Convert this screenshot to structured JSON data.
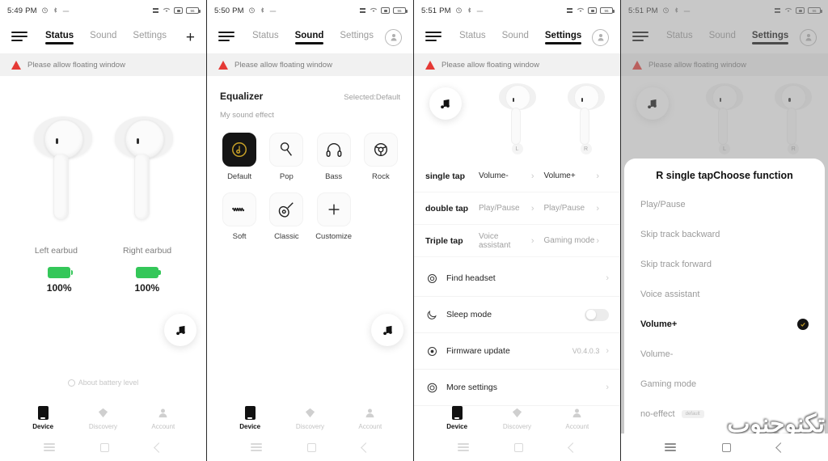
{
  "panels": [
    {
      "status": {
        "time": "5:49 PM",
        "icons": [
          "alarm-icon",
          "bluetooth-icon",
          "dash-icon"
        ],
        "right_icons": [
          "signal-icon",
          "wifi-icon",
          "screenshot-icon",
          "battery-icon"
        ],
        "battery_text": "96"
      },
      "tabs": [
        {
          "label": "Status",
          "active": true
        },
        {
          "label": "Sound",
          "active": false
        },
        {
          "label": "Settings",
          "active": false
        }
      ],
      "tab_right": {
        "type": "plus",
        "label": "+"
      },
      "warning": "Please allow floating window",
      "earbuds": {
        "left_label": "Left earbud",
        "right_label": "Right earbud",
        "left_battery": "100%",
        "right_battery": "100%",
        "battery_color": "#34c759"
      },
      "about": "About battery level",
      "bottom_nav": [
        {
          "label": "Device",
          "active": true
        },
        {
          "label": "Discovery",
          "active": false
        },
        {
          "label": "Account",
          "active": false
        }
      ]
    },
    {
      "status": {
        "time": "5:50 PM",
        "battery_text": "96"
      },
      "tabs": [
        {
          "label": "Status",
          "active": false
        },
        {
          "label": "Sound",
          "active": true
        },
        {
          "label": "Settings",
          "active": false
        }
      ],
      "tab_right": {
        "type": "avatar"
      },
      "warning": "Please allow floating window",
      "equalizer": {
        "title": "Equalizer",
        "selected_label": "Selected:Default",
        "subtitle": "My sound effect",
        "presets": [
          {
            "label": "Default",
            "icon": "disc-icon",
            "selected": true
          },
          {
            "label": "Pop",
            "icon": "microphone-icon",
            "selected": false
          },
          {
            "label": "Bass",
            "icon": "headphones-icon",
            "selected": false
          },
          {
            "label": "Rock",
            "icon": "rock-disc-icon",
            "selected": false
          },
          {
            "label": "Soft",
            "icon": "wave-icon",
            "selected": false
          },
          {
            "label": "Classic",
            "icon": "guitar-icon",
            "selected": false
          },
          {
            "label": "Customize",
            "icon": "plus-icon",
            "selected": false
          }
        ]
      },
      "bottom_nav": [
        {
          "label": "Device",
          "active": true
        },
        {
          "label": "Discovery",
          "active": false
        },
        {
          "label": "Account",
          "active": false
        }
      ]
    },
    {
      "status": {
        "time": "5:51 PM",
        "battery_text": "96"
      },
      "tabs": [
        {
          "label": "Status",
          "active": false
        },
        {
          "label": "Sound",
          "active": false
        },
        {
          "label": "Settings",
          "active": true
        }
      ],
      "tab_right": {
        "type": "avatar"
      },
      "warning": "Please allow floating window",
      "bud_badges": {
        "left": "L",
        "right": "R"
      },
      "tap_rows": [
        {
          "name": "single tap",
          "left": "Volume-",
          "right": "Volume+",
          "strong": true
        },
        {
          "name": "double tap",
          "left": "Play/Pause",
          "right": "Play/Pause",
          "strong": false
        },
        {
          "name": "Triple tap",
          "left": "Voice assistant",
          "right": "Gaming mode",
          "strong": false
        }
      ],
      "settings_rows": [
        {
          "label": "Find headset",
          "icon": "target-icon",
          "type": "chevron",
          "value": ""
        },
        {
          "label": "Sleep mode",
          "icon": "moon-icon",
          "type": "toggle",
          "value": ""
        },
        {
          "label": "Firmware update",
          "icon": "update-icon",
          "type": "chevron",
          "value": "V0.4.0.3"
        },
        {
          "label": "More settings",
          "icon": "gear-circle-icon",
          "type": "chevron",
          "value": ""
        }
      ],
      "bottom_nav": [
        {
          "label": "Device",
          "active": true
        },
        {
          "label": "Discovery",
          "active": false
        },
        {
          "label": "Account",
          "active": false
        }
      ]
    },
    {
      "status": {
        "time": "5:51 PM",
        "battery_text": "96"
      },
      "tabs": [
        {
          "label": "Status",
          "active": false
        },
        {
          "label": "Sound",
          "active": false
        },
        {
          "label": "Settings",
          "active": true
        }
      ],
      "tab_right": {
        "type": "avatar"
      },
      "warning": "Please allow floating window",
      "dialog": {
        "title": "R single tapChoose function",
        "options": [
          {
            "label": "Play/Pause",
            "selected": false,
            "badge": ""
          },
          {
            "label": "Skip track backward",
            "selected": false,
            "badge": ""
          },
          {
            "label": "Skip track forward",
            "selected": false,
            "badge": ""
          },
          {
            "label": "Voice assistant",
            "selected": false,
            "badge": ""
          },
          {
            "label": "Volume+",
            "selected": true,
            "badge": ""
          },
          {
            "label": "Volume-",
            "selected": false,
            "badge": ""
          },
          {
            "label": "Gaming mode",
            "selected": false,
            "badge": ""
          },
          {
            "label": "no-effect",
            "selected": false,
            "badge": "default"
          }
        ]
      }
    }
  ],
  "watermark": "تكنوجنوب"
}
